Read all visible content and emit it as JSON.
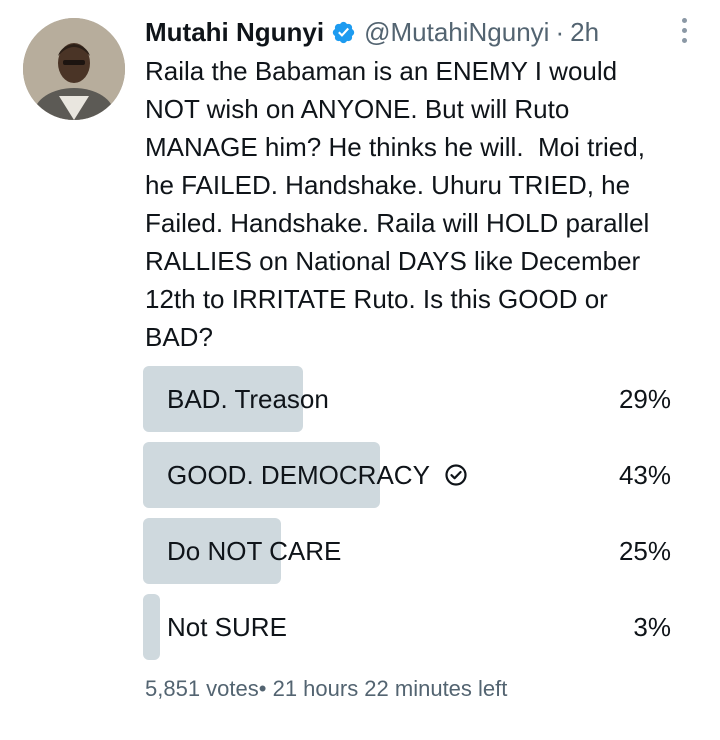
{
  "author": {
    "name": "Mutahi Ngunyi",
    "handle": "@MutahiNgunyi",
    "separator": "·",
    "time": "2h",
    "avatar": "avatar",
    "verified_icon": "verified-badge-icon",
    "verified_color": "#1d9bf0"
  },
  "tweet": {
    "text": "Raila the Babaman is an ENEMY I would\nNOT wish on ANYONE. But will Ruto\nMANAGE him? He thinks he will.  Moi tried,\nhe FAILED. Handshake. Uhuru TRIED, he\nFailed. Handshake. Raila will HOLD parallel\nRALLIES on National DAYS like December\n12th to IRRITATE Ruto. Is this GOOD or\nBAD?"
  },
  "poll": {
    "options": [
      {
        "label": "BAD. Treason",
        "percent": "29%",
        "fraction": 0.29,
        "winner": false
      },
      {
        "label": "GOOD. DEMOCRACY",
        "percent": "43%",
        "fraction": 0.43,
        "winner": true
      },
      {
        "label": "Do NOT CARE",
        "percent": "25%",
        "fraction": 0.25,
        "winner": false
      },
      {
        "label": "Not SURE",
        "percent": "3%",
        "fraction": 0.03,
        "winner": false
      }
    ],
    "votes": "5,851 votes",
    "bullet": "•",
    "time_left": "21 hours 22 minutes left",
    "bar_color": "#cfd9de",
    "winner_icon": "check-circle-icon"
  },
  "more_icon": "more-options-icon"
}
